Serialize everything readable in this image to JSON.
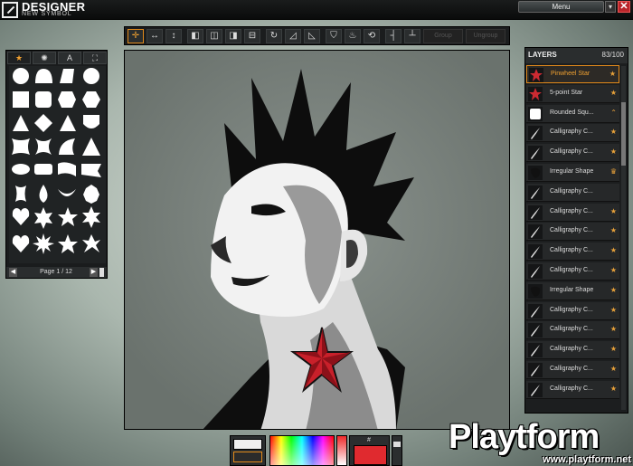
{
  "app": {
    "title": "DESIGNER",
    "subtitle": "NEW SYMBOL",
    "menu_label": "Menu",
    "menu_arrow": "▾",
    "close_label": "✕"
  },
  "toolbar": {
    "tools": [
      "move-tool",
      "horizontal-resize-tool",
      "vertical-resize-tool",
      "align-left-tool",
      "align-center-tool",
      "align-right-tool",
      "align-bottom-tool",
      "rotate-tool",
      "skew-tool",
      "distort-tool",
      "fill-tool",
      "color-tool",
      "transform-tool",
      "split-vertical-tool",
      "split-horizontal-tool"
    ],
    "glyphs": [
      "✛",
      "↔",
      "↕",
      "◧",
      "◫",
      "◨",
      "⊟",
      "↻",
      "◿",
      "◺",
      "⛉",
      "♨",
      "⟲",
      "┤",
      "┴"
    ],
    "disabled_a": "Group",
    "disabled_b": "Ungroup"
  },
  "shapes": {
    "tabs": [
      "★",
      "✺",
      "A",
      "⛶"
    ],
    "pagination": {
      "prev": "◀",
      "label": "Page 1 / 12",
      "next": "▶"
    }
  },
  "layers": {
    "title": "LAYERS",
    "count": "83/100",
    "items": [
      {
        "name": "Pinwheel Star",
        "star": "★",
        "icon": "star-icon"
      },
      {
        "name": "5-point Star",
        "star": "★",
        "icon": "star-icon"
      },
      {
        "name": "Rounded Squ...",
        "star": "⌃",
        "icon": "square-icon"
      },
      {
        "name": "Calligraphy C...",
        "star": "★",
        "icon": "brush-stroke-icon"
      },
      {
        "name": "Calligraphy C...",
        "star": "★",
        "icon": "brush-stroke-icon"
      },
      {
        "name": "Irregular Shape",
        "star": "♛",
        "icon": "blob-icon"
      },
      {
        "name": "Calligraphy C...",
        "star": "",
        "icon": "brush-stroke-icon"
      },
      {
        "name": "Calligraphy C...",
        "star": "★",
        "icon": "brush-stroke-icon"
      },
      {
        "name": "Calligraphy C...",
        "star": "★",
        "icon": "brush-stroke-icon"
      },
      {
        "name": "Calligraphy C...",
        "star": "★",
        "icon": "brush-stroke-icon"
      },
      {
        "name": "Calligraphy C...",
        "star": "★",
        "icon": "brush-stroke-icon"
      },
      {
        "name": "Irregular Shape",
        "star": "★",
        "icon": "blob-icon"
      },
      {
        "name": "Calligraphy C...",
        "star": "★",
        "icon": "brush-stroke-icon"
      },
      {
        "name": "Calligraphy C...",
        "star": "★",
        "icon": "brush-stroke-icon"
      },
      {
        "name": "Calligraphy C...",
        "star": "★",
        "icon": "brush-stroke-icon"
      },
      {
        "name": "Calligraphy C...",
        "star": "★",
        "icon": "brush-stroke-icon"
      },
      {
        "name": "Calligraphy C...",
        "star": "★",
        "icon": "brush-stroke-icon"
      }
    ]
  },
  "color": {
    "hex_label": "#",
    "current": "#e02a2f"
  },
  "watermark": {
    "text": "Playtform",
    "url": "www.playtform.net"
  }
}
